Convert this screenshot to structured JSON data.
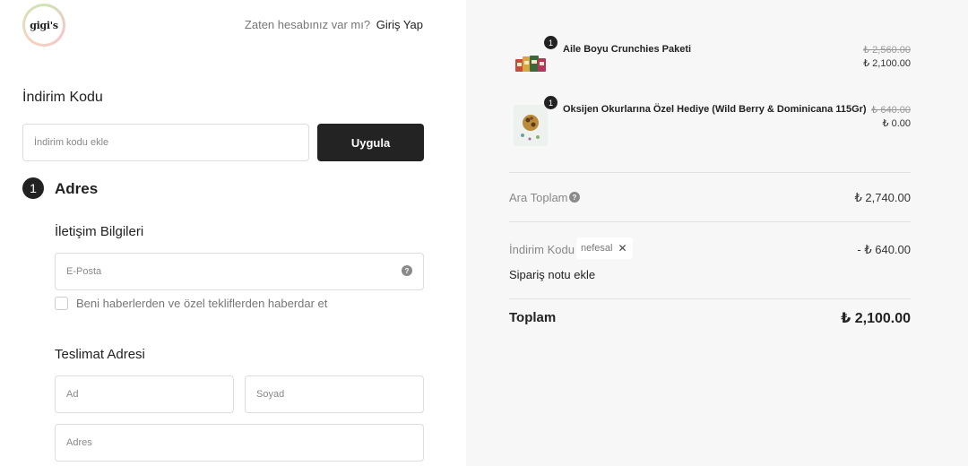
{
  "logo": {
    "text": "gigi's"
  },
  "header": {
    "prompt": "Zaten hesabınız var mı?",
    "login_link": "Giriş Yap"
  },
  "discount": {
    "title": "İndirim Kodu",
    "placeholder": "İndirim kodu ekle",
    "apply_label": "Uygula"
  },
  "address_step": {
    "number": "1",
    "title": "Adres",
    "contact_title": "İletişim Bilgileri",
    "email_placeholder": "E-Posta",
    "newsletter_label": "Beni haberlerden ve özel tekliflerden haberdar et",
    "delivery_title": "Teslimat Adresi",
    "first_name_placeholder": "Ad",
    "last_name_placeholder": "Soyad",
    "address_placeholder": "Adres"
  },
  "cart": {
    "items": [
      {
        "quantity": "1",
        "name": "Aile Boyu Crunchies Paketi",
        "old_price": "₺ 2,560.00",
        "price": "₺ 2,100.00",
        "image": "product-pack-image"
      },
      {
        "quantity": "1",
        "name": "Oksijen Okurlarına Özel Hediye (Wild Berry & Dominicana 115Gr)",
        "old_price": "₺ 640.00",
        "price": "₺ 0.00",
        "image": "product-gift-image"
      }
    ],
    "subtotal_label": "Ara Toplam",
    "subtotal_value": "₺ 2,740.00",
    "discount_label": "İndirim Kodu",
    "discount_code": "nefesal",
    "discount_value": "- ₺ 640.00",
    "note_link": "Sipariş notu ekle",
    "total_label": "Toplam",
    "total_value": "₺ 2,100.00"
  },
  "icons": {
    "help": "question-icon",
    "remove": "close-icon"
  },
  "colors": {
    "primary_button": "#232323",
    "summary_bg": "#f7f7f7"
  }
}
